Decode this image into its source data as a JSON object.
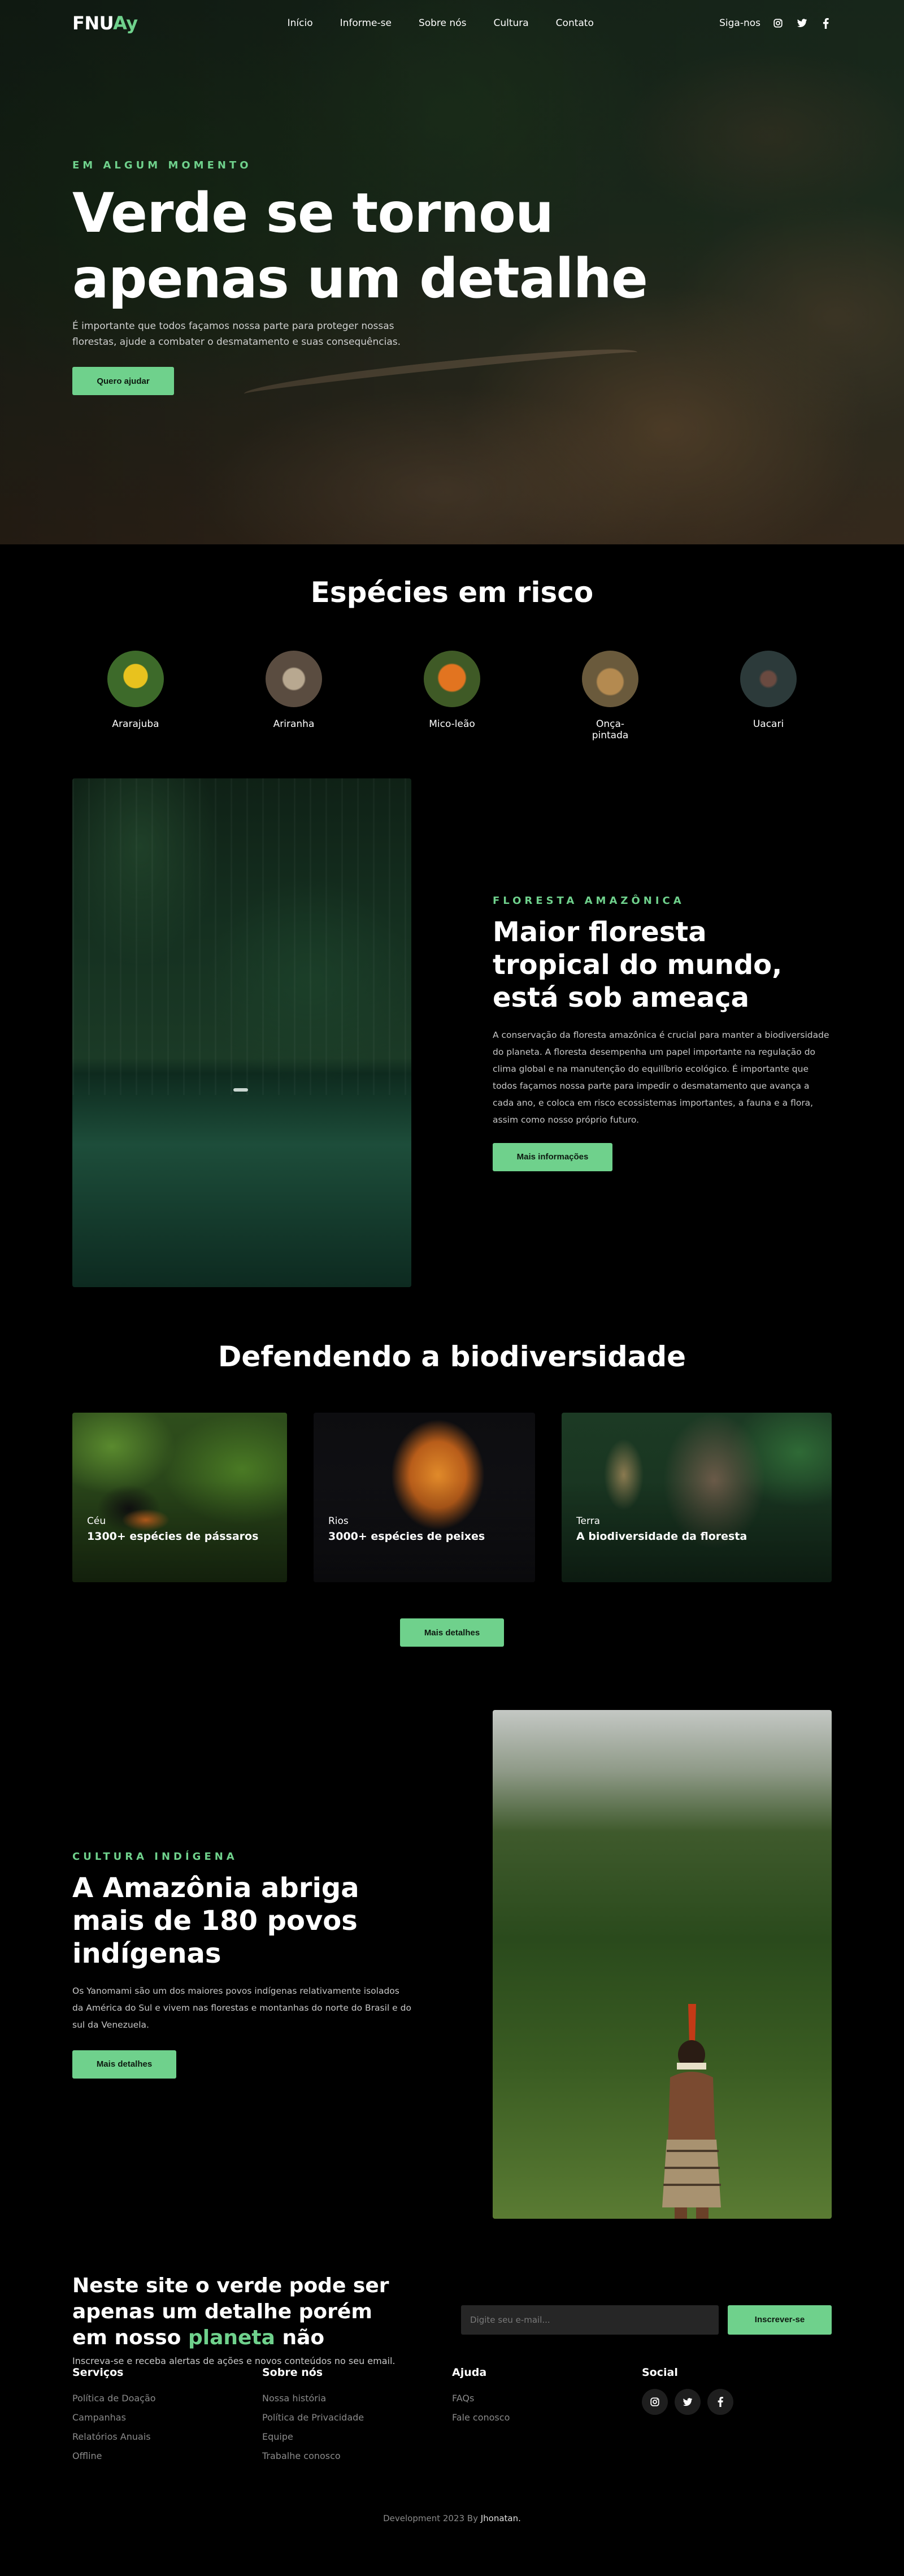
{
  "nav": {
    "logo_main": "FNU",
    "logo_accent": "Ay",
    "items": [
      "Início",
      "Informe-se",
      "Sobre nós",
      "Cultura",
      "Contato"
    ],
    "follow_label": "Siga-nos",
    "social_icons": [
      "instagram-icon",
      "twitter-icon",
      "facebook-icon"
    ]
  },
  "hero": {
    "eyebrow": "EM ALGUM MOMENTO",
    "title_line1": "Verde se tornou",
    "title_line2": "apenas um detalhe",
    "text": "É importante que todos façamos nossa parte para proteger nossas florestas, ajude a combater o desmatamento e suas consequências.",
    "button": "Quero ajudar"
  },
  "species": {
    "title": "Espécies em risco",
    "items": [
      {
        "name": "Ararajuba",
        "color": "#d6b21c"
      },
      {
        "name": "Ariranha",
        "color": "#8a7a68"
      },
      {
        "name": "Mico-leão",
        "color": "#d4661a"
      },
      {
        "name": "Onça-pintada",
        "color": "#9a7a4a"
      },
      {
        "name": "Uacari",
        "color": "#3a4a48"
      }
    ]
  },
  "forest": {
    "eyebrow": "FLORESTA AMAZÔNICA",
    "title": "Maior floresta tropical do mundo, está sob ameaça",
    "text": "A conservação da floresta amazônica é crucial para manter a biodiversidade do planeta. A floresta desempenha um papel importante na regulação do clima global e na manutenção do equilíbrio ecológico. É importante que todos façamos nossa parte para impedir o desmatamento que avança a cada ano, e coloca em risco ecossistemas importantes, a fauna e a flora, assim como nosso próprio futuro.",
    "button": "Mais informações"
  },
  "bio": {
    "title": "Defendendo a biodiversidade",
    "cards": [
      {
        "label": "Céu",
        "text": "1300+ espécies de pássaros"
      },
      {
        "label": "Rios",
        "text": "3000+ espécies de peixes"
      },
      {
        "label": "Terra",
        "text": "A biodiversidade da floresta"
      }
    ],
    "button": "Mais detalhes"
  },
  "indig": {
    "eyebrow": "CULTURA INDÍGENA",
    "title": "A Amazônia abriga mais de 180 povos indígenas",
    "text": "Os Yanomami são um dos maiores povos indígenas relativamente isolados da América do Sul e vivem nas florestas e montanhas do norte do Brasil e do sul da Venezuela.",
    "button": "Mais detalhes"
  },
  "news": {
    "title_part1": "Neste site o verde pode ser apenas um detalhe porém em nosso ",
    "title_accent": "planeta",
    "title_part2": " não",
    "sub": "Inscreva-se e receba alertas de ações e novos conteúdos no seu email.",
    "placeholder": "Digite seu e-mail...",
    "button": "Inscrever-se"
  },
  "footer": {
    "cols": [
      {
        "title": "Serviços",
        "links": [
          "Política de Doação",
          "Campanhas",
          "Relatórios Anuais",
          "Offline"
        ]
      },
      {
        "title": "Sobre nós",
        "links": [
          "Nossa história",
          "Política de Privacidade",
          "Equipe",
          "Trabalhe conosco"
        ]
      },
      {
        "title": "Ajuda",
        "links": [
          "FAQs",
          "Fale conosco"
        ]
      }
    ],
    "social_title": "Social",
    "social_icons": [
      "instagram-icon",
      "twitter-icon",
      "facebook-icon"
    ],
    "copyright_prefix": "Development 2023 By ",
    "copyright_name": "Jhonatan."
  },
  "colors": {
    "accent": "#6fd18c",
    "background": "#000000"
  }
}
